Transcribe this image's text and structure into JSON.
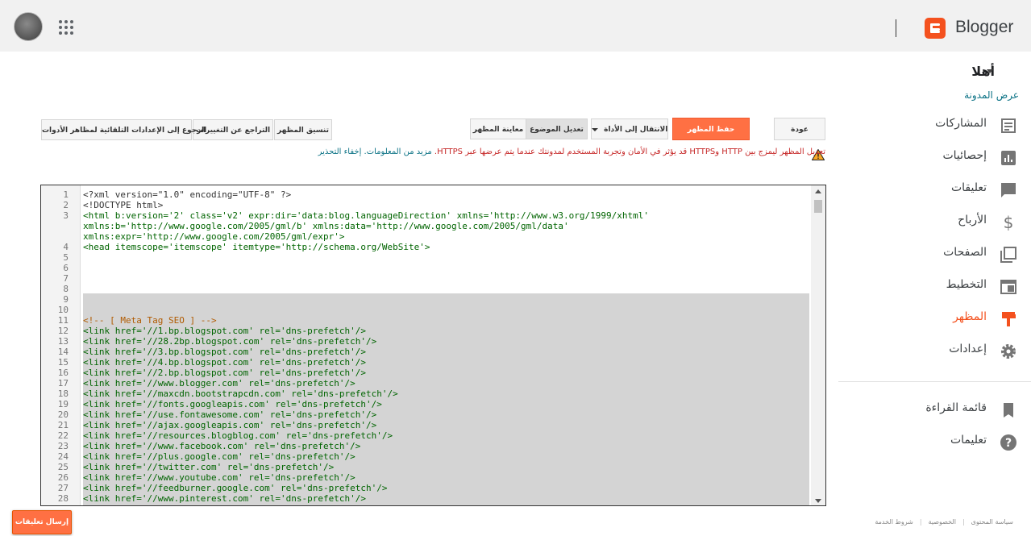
{
  "header": {
    "brand": "Blogger"
  },
  "sidebar": {
    "greeting": "أهلا",
    "view_blog": "عرض المدونة",
    "items": [
      {
        "label": "المشاركات",
        "icon": "posts-icon"
      },
      {
        "label": "إحصائيات",
        "icon": "stats-icon"
      },
      {
        "label": "تعليقات",
        "icon": "comments-icon"
      },
      {
        "label": "الأرباح",
        "icon": "earnings-icon"
      },
      {
        "label": "الصفحات",
        "icon": "pages-icon"
      },
      {
        "label": "التخطيط",
        "icon": "layout-icon"
      },
      {
        "label": "المظهر",
        "icon": "theme-icon",
        "active": true
      },
      {
        "label": "إعدادات",
        "icon": "settings-icon"
      }
    ],
    "secondary": [
      {
        "label": "قائمة القراءة",
        "icon": "bookmark-icon"
      },
      {
        "label": "تعليمات",
        "icon": "help-icon"
      }
    ]
  },
  "toolbar": {
    "back": "عودة",
    "save_theme": "حفظ المظهر",
    "jump_to_widget": "الانتقال إلى الأداة",
    "edit_theme": "تعديل الموضوع",
    "preview_theme": "معاينة المظهر",
    "format_theme": "تنسيق المظهر",
    "revert_changes": "التراجع عن التغييرات",
    "revert_widgets": "الرجوع إلى الإعدادات التلقائية لمظاهر الأدوات"
  },
  "warning": {
    "text": "تعديل المظهر ليمزج بين HTTP وHTTPS قد يؤثر في الأمان وتجربة المستخدم لمدونتك عندما يتم عرضها عبر HTTPS.",
    "links": "مزيد من المعلومات. إخفاء التحذير"
  },
  "editor": {
    "lines": [
      {
        "n": "1",
        "t": "<?xml version=\"1.0\" encoding=\"UTF-8\" ?>",
        "k": "plain"
      },
      {
        "n": "2",
        "t": "<!DOCTYPE html>",
        "k": "plain"
      },
      {
        "n": "3",
        "t": "<html b:version='2' class='v2' expr:dir='data:blog.languageDirection' xmlns='http://www.w3.org/1999/xhtml'",
        "k": "tag"
      },
      {
        "n": "",
        "t": "xmlns:b='http://www.google.com/2005/gml/b' xmlns:data='http://www.google.com/2005/gml/data'",
        "k": "tag"
      },
      {
        "n": "",
        "t": "xmlns:expr='http://www.google.com/2005/gml/expr'>",
        "k": "tag"
      },
      {
        "n": "4",
        "t": "<head itemscope='itemscope' itemtype='http://schema.org/WebSite'>",
        "k": "tag"
      },
      {
        "n": "5",
        "t": "",
        "k": "plain"
      },
      {
        "n": "6",
        "t": "",
        "k": "plain"
      },
      {
        "n": "7",
        "t": "",
        "k": "plain"
      },
      {
        "n": "8",
        "t": "",
        "k": "plain"
      },
      {
        "n": "9",
        "t": "",
        "k": "plain"
      },
      {
        "n": "10",
        "t": "",
        "k": "plain"
      },
      {
        "n": "11",
        "t": "<!-- [ Meta Tag SEO ] -->",
        "k": "cmt"
      },
      {
        "n": "12",
        "t": "<link href='//1.bp.blogspot.com' rel='dns-prefetch'/>",
        "k": "tag"
      },
      {
        "n": "13",
        "t": "<link href='//28.2bp.blogspot.com' rel='dns-prefetch'/>",
        "k": "tag"
      },
      {
        "n": "14",
        "t": "<link href='//3.bp.blogspot.com' rel='dns-prefetch'/>",
        "k": "tag"
      },
      {
        "n": "15",
        "t": "<link href='//4.bp.blogspot.com' rel='dns-prefetch'/>",
        "k": "tag"
      },
      {
        "n": "16",
        "t": "<link href='//2.bp.blogspot.com' rel='dns-prefetch'/>",
        "k": "tag"
      },
      {
        "n": "17",
        "t": "<link href='//www.blogger.com' rel='dns-prefetch'/>",
        "k": "tag"
      },
      {
        "n": "18",
        "t": "<link href='//maxcdn.bootstrapcdn.com' rel='dns-prefetch'/>",
        "k": "tag"
      },
      {
        "n": "19",
        "t": "<link href='//fonts.googleapis.com' rel='dns-prefetch'/>",
        "k": "tag"
      },
      {
        "n": "20",
        "t": "<link href='//use.fontawesome.com' rel='dns-prefetch'/>",
        "k": "tag"
      },
      {
        "n": "21",
        "t": "<link href='//ajax.googleapis.com' rel='dns-prefetch'/>",
        "k": "tag"
      },
      {
        "n": "22",
        "t": "<link href='//resources.blogblog.com' rel='dns-prefetch'/>",
        "k": "tag"
      },
      {
        "n": "23",
        "t": "<link href='//www.facebook.com' rel='dns-prefetch'/>",
        "k": "tag"
      },
      {
        "n": "24",
        "t": "<link href='//plus.google.com' rel='dns-prefetch'/>",
        "k": "tag"
      },
      {
        "n": "25",
        "t": "<link href='//twitter.com' rel='dns-prefetch'/>",
        "k": "tag"
      },
      {
        "n": "26",
        "t": "<link href='//www.youtube.com' rel='dns-prefetch'/>",
        "k": "tag"
      },
      {
        "n": "27",
        "t": "<link href='//feedburner.google.com' rel='dns-prefetch'/>",
        "k": "tag"
      },
      {
        "n": "28",
        "t": "<link href='//www.pinterest.com' rel='dns-prefetch'/>",
        "k": "tag"
      }
    ]
  },
  "feedback_button": "إرسال تعليقات",
  "footer": {
    "terms": "شروط الخدمة",
    "privacy": "الخصوصية",
    "content_policy": "سياسة المحتوى",
    "sep": "|"
  },
  "colors": {
    "accent": "#f4511e",
    "button_orange": "#ff7043",
    "link": "#0b7285",
    "warning": "#c62828"
  }
}
